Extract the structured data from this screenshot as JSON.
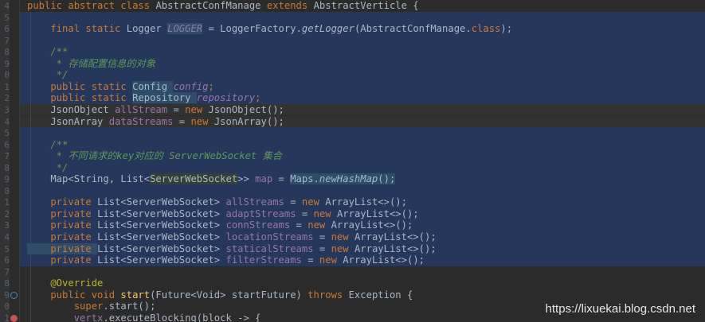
{
  "editor": {
    "gutter_numbers": [
      "4",
      "5",
      "6",
      "7",
      "8",
      "9",
      "0",
      "1",
      "2",
      "3",
      "4",
      "5",
      "6",
      "7",
      "8",
      "9",
      "0",
      "1",
      "2",
      "3",
      "4",
      "5",
      "6",
      "7",
      "8",
      "9",
      "0",
      "1"
    ],
    "lines": [
      {
        "tokens": [
          {
            "t": "public abstract class ",
            "c": "kw"
          },
          {
            "t": "AbstractConfManage ",
            "c": ""
          },
          {
            "t": "extends ",
            "c": "kw"
          },
          {
            "t": "AbstractVerticle {",
            "c": ""
          }
        ]
      },
      {
        "tokens": []
      },
      {
        "tokens": [
          {
            "t": "    final static ",
            "c": "kw"
          },
          {
            "t": "Logger ",
            "c": ""
          },
          {
            "t": "LOGGER",
            "c": "fld hlb"
          },
          {
            "t": " = LoggerFactory.",
            "c": ""
          },
          {
            "t": "getLogger",
            "c": "it"
          },
          {
            "t": "(AbstractConfManage.",
            "c": ""
          },
          {
            "t": "class",
            "c": "kw"
          },
          {
            "t": ");",
            "c": ""
          }
        ]
      },
      {
        "tokens": []
      },
      {
        "tokens": [
          {
            "t": "    /**",
            "c": "doc"
          }
        ]
      },
      {
        "tokens": [
          {
            "t": "     * 存储配置信息的对象",
            "c": "doc"
          }
        ]
      },
      {
        "tokens": [
          {
            "t": "     */",
            "c": "doc"
          }
        ]
      },
      {
        "tokens": [
          {
            "t": "    public static ",
            "c": "kw"
          },
          {
            "t": "Config ",
            "c": "hlb"
          },
          {
            "t": "config",
            "c": "fld"
          },
          {
            "t": ";",
            "c": "kw"
          }
        ]
      },
      {
        "tokens": [
          {
            "t": "    public static ",
            "c": "kw"
          },
          {
            "t": "Repository ",
            "c": "hlb"
          },
          {
            "t": "repository",
            "c": "fld"
          },
          {
            "t": ";",
            "c": "kw"
          }
        ]
      },
      {
        "tokens": [
          {
            "t": "    JsonObject ",
            "c": ""
          },
          {
            "t": "allStream",
            "c": "ifld"
          },
          {
            "t": " = ",
            "c": ""
          },
          {
            "t": "new ",
            "c": "kw"
          },
          {
            "t": "JsonObject();",
            "c": ""
          }
        ]
      },
      {
        "tokens": [
          {
            "t": "    JsonArray ",
            "c": ""
          },
          {
            "t": "dataStreams",
            "c": "ifld"
          },
          {
            "t": " = ",
            "c": ""
          },
          {
            "t": "new ",
            "c": "kw"
          },
          {
            "t": "JsonArray();",
            "c": ""
          }
        ]
      },
      {
        "tokens": []
      },
      {
        "tokens": [
          {
            "t": "    /**",
            "c": "doc"
          }
        ]
      },
      {
        "tokens": [
          {
            "t": "     * 不同请求的key对应的 ServerWebSocket 集合",
            "c": "doc"
          }
        ]
      },
      {
        "tokens": [
          {
            "t": "     */",
            "c": "doc"
          }
        ]
      },
      {
        "tokens": [
          {
            "t": "    Map<String, List<",
            "c": ""
          },
          {
            "t": "ServerWebSocket",
            "c": "hl"
          },
          {
            "t": ">> ",
            "c": ""
          },
          {
            "t": "map",
            "c": "ifld"
          },
          {
            "t": " = ",
            "c": ""
          },
          {
            "t": "Maps.",
            "c": "hlb"
          },
          {
            "t": "newHashMap",
            "c": "it hlb"
          },
          {
            "t": "();",
            "c": "hlb"
          }
        ]
      },
      {
        "tokens": []
      },
      {
        "tokens": [
          {
            "t": "    private ",
            "c": "kw"
          },
          {
            "t": "List<ServerWebSocket> ",
            "c": ""
          },
          {
            "t": "allStreams",
            "c": "ifld"
          },
          {
            "t": " = ",
            "c": ""
          },
          {
            "t": "new ",
            "c": "kw"
          },
          {
            "t": "ArrayList<>();",
            "c": ""
          }
        ]
      },
      {
        "tokens": [
          {
            "t": "    private ",
            "c": "kw"
          },
          {
            "t": "List<ServerWebSocket> ",
            "c": ""
          },
          {
            "t": "adaptStreams",
            "c": "ifld"
          },
          {
            "t": " = ",
            "c": ""
          },
          {
            "t": "new ",
            "c": "kw"
          },
          {
            "t": "ArrayList<>();",
            "c": ""
          }
        ]
      },
      {
        "tokens": [
          {
            "t": "    private ",
            "c": "kw"
          },
          {
            "t": "List<ServerWebSocket> ",
            "c": ""
          },
          {
            "t": "connStreams",
            "c": "ifld"
          },
          {
            "t": " = ",
            "c": ""
          },
          {
            "t": "new ",
            "c": "kw"
          },
          {
            "t": "ArrayList<>();",
            "c": ""
          }
        ]
      },
      {
        "tokens": [
          {
            "t": "    private ",
            "c": "kw"
          },
          {
            "t": "List<ServerWebSocket> ",
            "c": ""
          },
          {
            "t": "locationStreams",
            "c": "ifld"
          },
          {
            "t": " = ",
            "c": ""
          },
          {
            "t": "new ",
            "c": "kw"
          },
          {
            "t": "ArrayList<>();",
            "c": ""
          }
        ]
      },
      {
        "tokens": [
          {
            "t": "    private ",
            "c": "kw hlb"
          },
          {
            "t": "List<ServerWebSocket> ",
            "c": ""
          },
          {
            "t": "staticalStreams",
            "c": "ifld"
          },
          {
            "t": " = ",
            "c": ""
          },
          {
            "t": "new ",
            "c": "kw"
          },
          {
            "t": "ArrayList<>();",
            "c": ""
          }
        ]
      },
      {
        "tokens": [
          {
            "t": "    private ",
            "c": "kw"
          },
          {
            "t": "List<ServerWebSocket> ",
            "c": ""
          },
          {
            "t": "filterStreams",
            "c": "ifld"
          },
          {
            "t": " = ",
            "c": ""
          },
          {
            "t": "new ",
            "c": "kw"
          },
          {
            "t": "ArrayList<>();",
            "c": ""
          }
        ]
      },
      {
        "tokens": []
      },
      {
        "tokens": [
          {
            "t": "    @Override",
            "c": "ann"
          }
        ]
      },
      {
        "tokens": [
          {
            "t": "    public void ",
            "c": "kw"
          },
          {
            "t": "start",
            "c": "mth"
          },
          {
            "t": "(Future<Void> startFuture) ",
            "c": ""
          },
          {
            "t": "throws ",
            "c": "kw"
          },
          {
            "t": "Exception {",
            "c": ""
          }
        ]
      },
      {
        "tokens": [
          {
            "t": "        ",
            "c": ""
          },
          {
            "t": "super",
            "c": "kw"
          },
          {
            "t": ".start();",
            "c": ""
          }
        ]
      },
      {
        "tokens": [
          {
            "t": "        vertx",
            "c": "ifld"
          },
          {
            "t": ".executeBlocking(block -> {",
            "c": ""
          }
        ]
      }
    ],
    "selected_lines": [
      1,
      2,
      3,
      4,
      5,
      6,
      7,
      8,
      11,
      12,
      13,
      14,
      15,
      16,
      17,
      18,
      19,
      20,
      21,
      22
    ],
    "current_lines": [
      9,
      10
    ],
    "override_marker_line": 25,
    "debug_marker_line": 27
  },
  "watermark": "https://lixuekai.blog.csdn.net"
}
